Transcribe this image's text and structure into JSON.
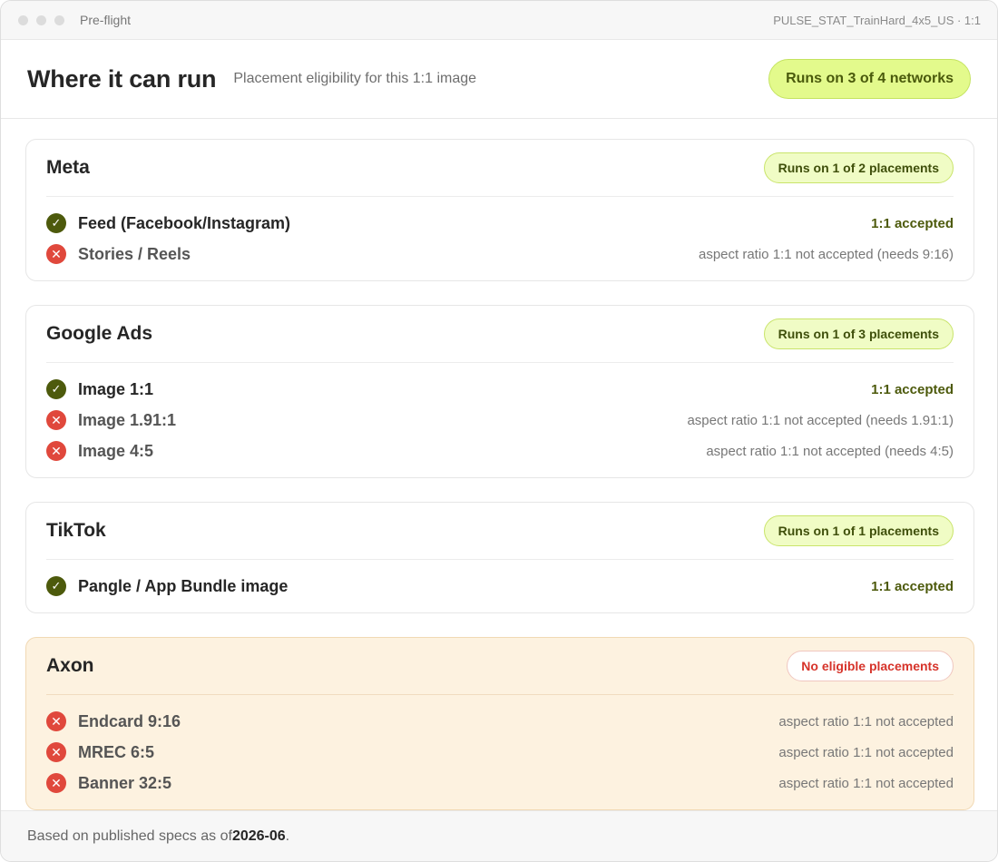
{
  "window": {
    "title": "Pre-flight",
    "file": "PULSE_STAT_TrainHard_4x5_US · 1:1"
  },
  "header": {
    "title": "Where it can run",
    "subtitle": "Placement eligibility for this 1:1 image",
    "summary": "Runs on 3 of 4 networks"
  },
  "networks": [
    {
      "name": "Meta",
      "summary": "Runs on 1 of 2 placements",
      "placements": [
        {
          "label": "Feed (Facebook/Instagram)",
          "result": "1:1 accepted",
          "ok": true
        },
        {
          "label": "Stories / Reels",
          "result": "aspect ratio 1:1 not accepted (needs 9:16)",
          "ok": false
        }
      ]
    },
    {
      "name": "Google Ads",
      "summary": "Runs on 1 of 3 placements",
      "placements": [
        {
          "label": "Image 1:1",
          "result": "1:1 accepted",
          "ok": true
        },
        {
          "label": "Image 1.91:1",
          "result": "aspect ratio 1:1 not accepted (needs 1.91:1)",
          "ok": false
        },
        {
          "label": "Image 4:5",
          "result": "aspect ratio 1:1 not accepted (needs 4:5)",
          "ok": false
        }
      ]
    },
    {
      "name": "TikTok",
      "summary": "Runs on 1 of 1 placements",
      "placements": [
        {
          "label": "Pangle / App Bundle image",
          "result": "1:1 accepted",
          "ok": true
        }
      ]
    },
    {
      "name": "Axon",
      "summary": "No eligible placements",
      "placements": [
        {
          "label": "Endcard 9:16",
          "result": "aspect ratio 1:1 not accepted",
          "ok": false
        },
        {
          "label": "MREC 6:5",
          "result": "aspect ratio 1:1 not accepted",
          "ok": false
        },
        {
          "label": "Banner 32:5",
          "result": "aspect ratio 1:1 not accepted",
          "ok": false
        }
      ]
    }
  ],
  "footer": {
    "prefix": "Based on published specs as of ",
    "date": "2026-06",
    "suffix": "."
  },
  "icons": {
    "ok": "check-icon",
    "bad": "x-icon"
  },
  "colors": {
    "accent_pill": "#e3fa8c",
    "ok": "#4d5a0c",
    "bad": "#e0483c",
    "warn_card": "#fdf2e0"
  }
}
